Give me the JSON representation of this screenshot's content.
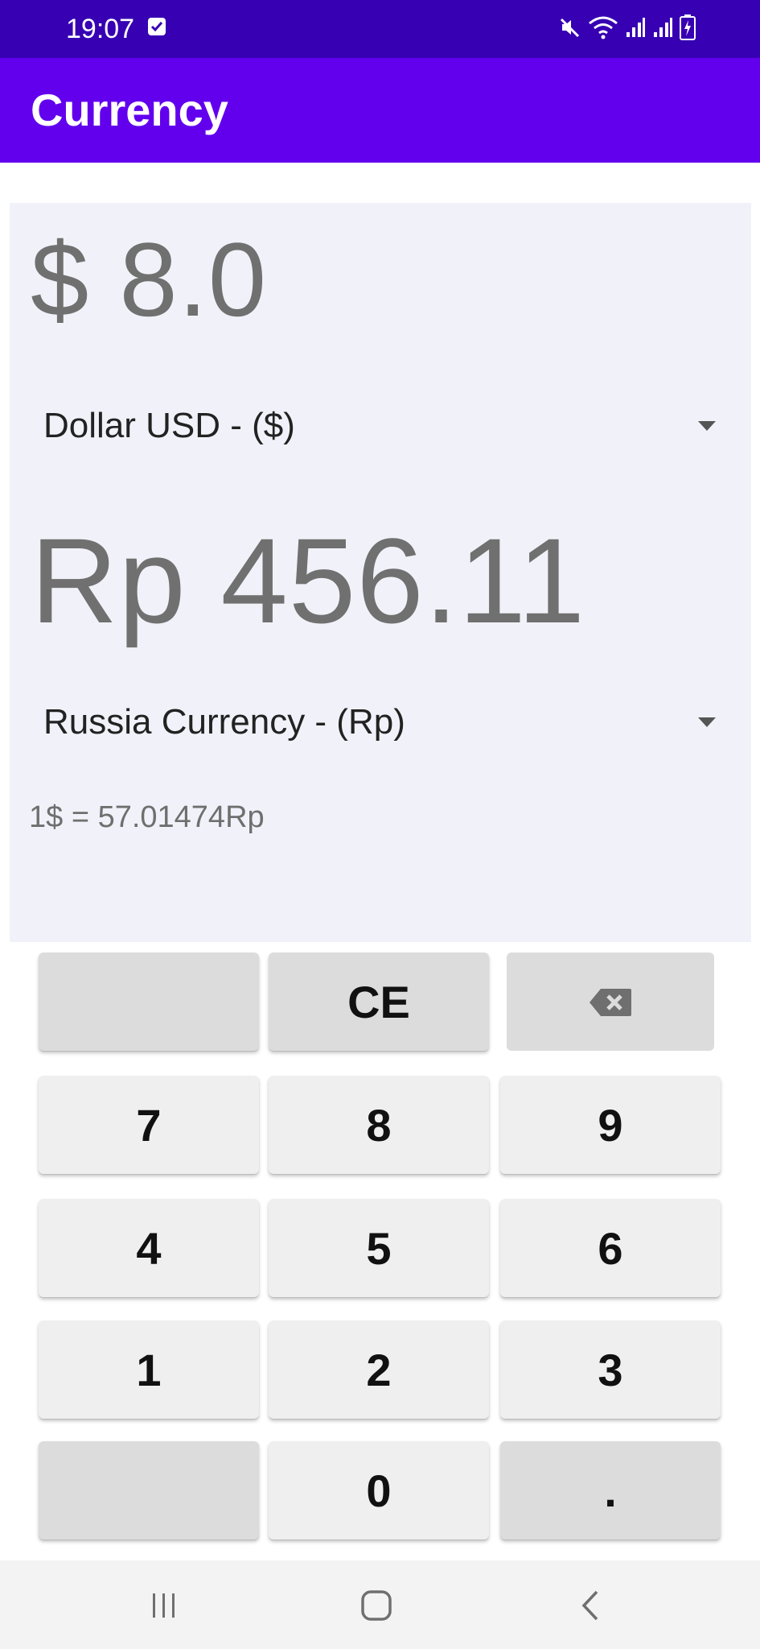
{
  "status_bar": {
    "time": "19:07",
    "icons": [
      "checkbox-notification-icon",
      "mute-icon",
      "wifi-icon",
      "signal-icon",
      "signal-icon",
      "battery-charging-icon"
    ]
  },
  "app_bar": {
    "title": "Currency"
  },
  "converter": {
    "from_amount": "$ 8.0",
    "from_currency": "Dollar USD - ($)",
    "to_amount": "Rp 456.11",
    "to_currency": "Russia Currency - (Rp)",
    "rate": "1$ = 57.01474Rp"
  },
  "keypad": {
    "rows": [
      [
        "",
        "CE",
        "backspace-icon"
      ],
      [
        "7",
        "8",
        "9"
      ],
      [
        "4",
        "5",
        "6"
      ],
      [
        "1",
        "2",
        "3"
      ],
      [
        "",
        "0",
        "."
      ]
    ]
  },
  "nav_bar": {
    "icons": [
      "recent-apps-icon",
      "home-icon",
      "back-icon"
    ]
  },
  "colors": {
    "status_bar": "#3700b3",
    "app_bar": "#6200ee",
    "panel": "#f1f2f9",
    "key": "#efefef",
    "key_dark": "#dcdcdc"
  }
}
